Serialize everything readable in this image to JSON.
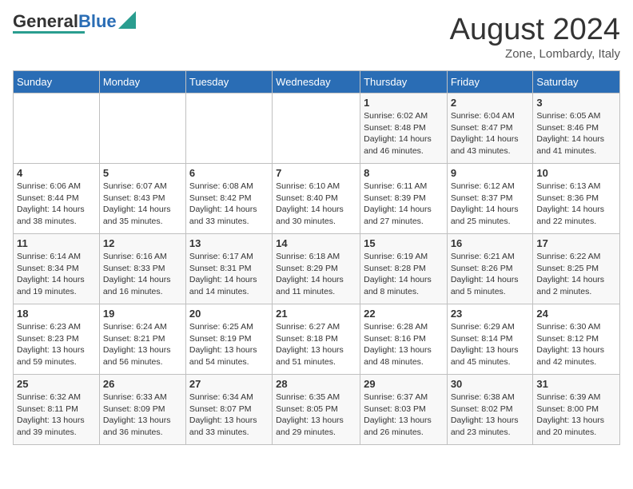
{
  "header": {
    "logo_general": "General",
    "logo_blue": "Blue",
    "month_title": "August 2024",
    "subtitle": "Zone, Lombardy, Italy"
  },
  "weekdays": [
    "Sunday",
    "Monday",
    "Tuesday",
    "Wednesday",
    "Thursday",
    "Friday",
    "Saturday"
  ],
  "weeks": [
    [
      {
        "day": "",
        "info": ""
      },
      {
        "day": "",
        "info": ""
      },
      {
        "day": "",
        "info": ""
      },
      {
        "day": "",
        "info": ""
      },
      {
        "day": "1",
        "info": "Sunrise: 6:02 AM\nSunset: 8:48 PM\nDaylight: 14 hours and 46 minutes."
      },
      {
        "day": "2",
        "info": "Sunrise: 6:04 AM\nSunset: 8:47 PM\nDaylight: 14 hours and 43 minutes."
      },
      {
        "day": "3",
        "info": "Sunrise: 6:05 AM\nSunset: 8:46 PM\nDaylight: 14 hours and 41 minutes."
      }
    ],
    [
      {
        "day": "4",
        "info": "Sunrise: 6:06 AM\nSunset: 8:44 PM\nDaylight: 14 hours and 38 minutes."
      },
      {
        "day": "5",
        "info": "Sunrise: 6:07 AM\nSunset: 8:43 PM\nDaylight: 14 hours and 35 minutes."
      },
      {
        "day": "6",
        "info": "Sunrise: 6:08 AM\nSunset: 8:42 PM\nDaylight: 14 hours and 33 minutes."
      },
      {
        "day": "7",
        "info": "Sunrise: 6:10 AM\nSunset: 8:40 PM\nDaylight: 14 hours and 30 minutes."
      },
      {
        "day": "8",
        "info": "Sunrise: 6:11 AM\nSunset: 8:39 PM\nDaylight: 14 hours and 27 minutes."
      },
      {
        "day": "9",
        "info": "Sunrise: 6:12 AM\nSunset: 8:37 PM\nDaylight: 14 hours and 25 minutes."
      },
      {
        "day": "10",
        "info": "Sunrise: 6:13 AM\nSunset: 8:36 PM\nDaylight: 14 hours and 22 minutes."
      }
    ],
    [
      {
        "day": "11",
        "info": "Sunrise: 6:14 AM\nSunset: 8:34 PM\nDaylight: 14 hours and 19 minutes."
      },
      {
        "day": "12",
        "info": "Sunrise: 6:16 AM\nSunset: 8:33 PM\nDaylight: 14 hours and 16 minutes."
      },
      {
        "day": "13",
        "info": "Sunrise: 6:17 AM\nSunset: 8:31 PM\nDaylight: 14 hours and 14 minutes."
      },
      {
        "day": "14",
        "info": "Sunrise: 6:18 AM\nSunset: 8:29 PM\nDaylight: 14 hours and 11 minutes."
      },
      {
        "day": "15",
        "info": "Sunrise: 6:19 AM\nSunset: 8:28 PM\nDaylight: 14 hours and 8 minutes."
      },
      {
        "day": "16",
        "info": "Sunrise: 6:21 AM\nSunset: 8:26 PM\nDaylight: 14 hours and 5 minutes."
      },
      {
        "day": "17",
        "info": "Sunrise: 6:22 AM\nSunset: 8:25 PM\nDaylight: 14 hours and 2 minutes."
      }
    ],
    [
      {
        "day": "18",
        "info": "Sunrise: 6:23 AM\nSunset: 8:23 PM\nDaylight: 13 hours and 59 minutes."
      },
      {
        "day": "19",
        "info": "Sunrise: 6:24 AM\nSunset: 8:21 PM\nDaylight: 13 hours and 56 minutes."
      },
      {
        "day": "20",
        "info": "Sunrise: 6:25 AM\nSunset: 8:19 PM\nDaylight: 13 hours and 54 minutes."
      },
      {
        "day": "21",
        "info": "Sunrise: 6:27 AM\nSunset: 8:18 PM\nDaylight: 13 hours and 51 minutes."
      },
      {
        "day": "22",
        "info": "Sunrise: 6:28 AM\nSunset: 8:16 PM\nDaylight: 13 hours and 48 minutes."
      },
      {
        "day": "23",
        "info": "Sunrise: 6:29 AM\nSunset: 8:14 PM\nDaylight: 13 hours and 45 minutes."
      },
      {
        "day": "24",
        "info": "Sunrise: 6:30 AM\nSunset: 8:12 PM\nDaylight: 13 hours and 42 minutes."
      }
    ],
    [
      {
        "day": "25",
        "info": "Sunrise: 6:32 AM\nSunset: 8:11 PM\nDaylight: 13 hours and 39 minutes."
      },
      {
        "day": "26",
        "info": "Sunrise: 6:33 AM\nSunset: 8:09 PM\nDaylight: 13 hours and 36 minutes."
      },
      {
        "day": "27",
        "info": "Sunrise: 6:34 AM\nSunset: 8:07 PM\nDaylight: 13 hours and 33 minutes."
      },
      {
        "day": "28",
        "info": "Sunrise: 6:35 AM\nSunset: 8:05 PM\nDaylight: 13 hours and 29 minutes."
      },
      {
        "day": "29",
        "info": "Sunrise: 6:37 AM\nSunset: 8:03 PM\nDaylight: 13 hours and 26 minutes."
      },
      {
        "day": "30",
        "info": "Sunrise: 6:38 AM\nSunset: 8:02 PM\nDaylight: 13 hours and 23 minutes."
      },
      {
        "day": "31",
        "info": "Sunrise: 6:39 AM\nSunset: 8:00 PM\nDaylight: 13 hours and 20 minutes."
      }
    ]
  ]
}
